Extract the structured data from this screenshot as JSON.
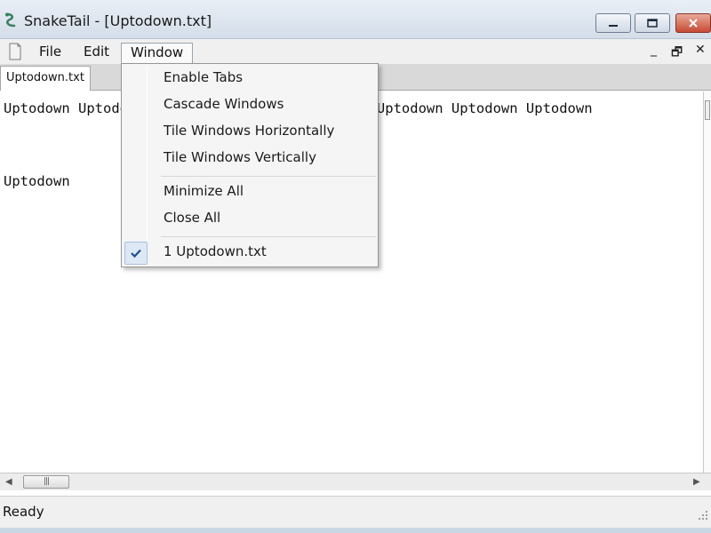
{
  "window": {
    "title": "SnakeTail - [Uptodown.txt]"
  },
  "menubar": {
    "items": [
      "File",
      "Edit",
      "Window"
    ],
    "mdi_minimize": "_",
    "mdi_restore": "🗗",
    "mdi_close": "✕"
  },
  "tabs": [
    {
      "label": "Uptodown.txt"
    }
  ],
  "content": {
    "lines": [
      "Uptodown Uptodown Uptodown Uptodown Uptodown Uptodown Uptodown Uptodown",
      "Uptodown"
    ]
  },
  "window_menu": {
    "items": [
      {
        "label": "Enable Tabs"
      },
      {
        "label": "Cascade Windows"
      },
      {
        "label": "Tile Windows Horizontally"
      },
      {
        "label": "Tile Windows Vertically"
      },
      {
        "label": "Minimize All"
      },
      {
        "label": "Close All"
      },
      {
        "label": "1 Uptodown.txt",
        "checked": true
      }
    ]
  },
  "scrollbar": {
    "thumb_grip": "|||"
  },
  "status": {
    "text": "Ready"
  },
  "colors": {
    "accent": "#2f6db5",
    "close_button": "#c74a33",
    "check": "#1f4f8c"
  },
  "icons": {
    "app": "snake-icon",
    "document": "document-icon",
    "minimize": "minimize-icon",
    "maximize": "maximize-icon",
    "close": "close-icon",
    "check": "check-icon"
  }
}
